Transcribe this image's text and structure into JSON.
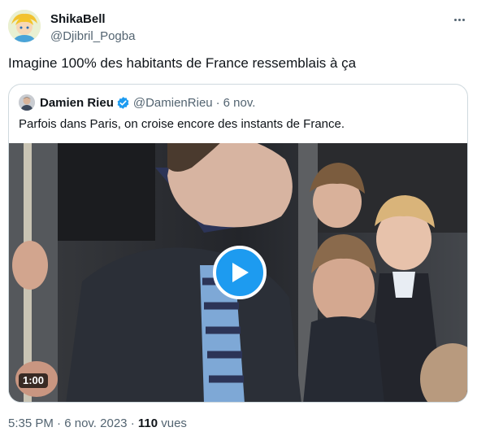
{
  "author": {
    "name": "ShikaBell",
    "handle": "@Djibril_Pogba"
  },
  "tweet": {
    "text": "Imagine 100% des habitants de France ressemblais à ça"
  },
  "quoted": {
    "name": "Damien Rieu",
    "handle": "@DamienRieu",
    "separator": "·",
    "date": "6 nov.",
    "text": "Parfois dans Paris, on croise encore des instants de France.",
    "video": {
      "duration": "1:00"
    }
  },
  "meta": {
    "time": "5:35 PM",
    "separator": "·",
    "date": "6 nov. 2023",
    "views_count": "110",
    "views_label": "vues"
  },
  "colors": {
    "accent": "#1d9bf0",
    "secondary_text": "#536471",
    "border": "#cfd9de"
  }
}
